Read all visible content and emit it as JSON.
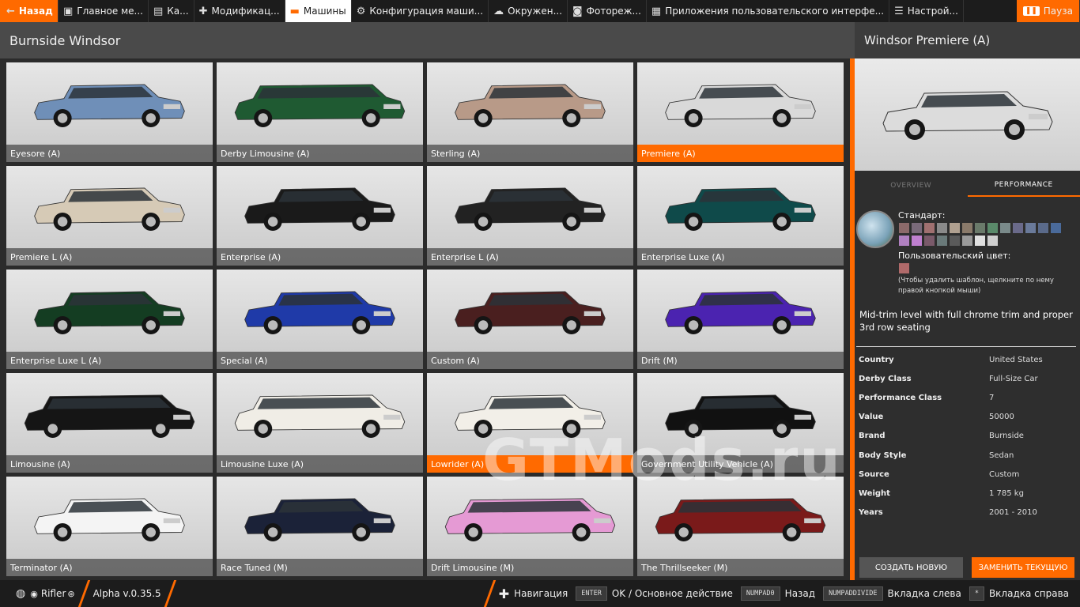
{
  "topbar": {
    "back_label": "Назад",
    "tabs": [
      {
        "label": "Главное ме...",
        "icon": "grid-icon"
      },
      {
        "label": "Ка...",
        "icon": "map-icon"
      },
      {
        "label": "Модификац...",
        "icon": "puzzle-icon"
      },
      {
        "label": "Машины",
        "icon": "car-icon",
        "active": true
      },
      {
        "label": "Конфигурация маши...",
        "icon": "engine-icon"
      },
      {
        "label": "Окружен...",
        "icon": "weather-icon"
      },
      {
        "label": "Фотореж...",
        "icon": "camera-icon"
      },
      {
        "label": "Приложения пользовательского интерфе...",
        "icon": "apps-icon"
      },
      {
        "label": "Настрой...",
        "icon": "sliders-icon"
      }
    ],
    "pause_label": "Пауза"
  },
  "left_header": {
    "title": "Burnside Windsor"
  },
  "vehicles": [
    {
      "label": "Eyesore (A)",
      "color": "#6f8fb8",
      "style": "sedan"
    },
    {
      "label": "Derby Limousine (A)",
      "color": "#1f5a32",
      "style": "limo"
    },
    {
      "label": "Sterling (A)",
      "color": "#b89a88",
      "style": "sedan"
    },
    {
      "label": "Premiere (A)",
      "color": "#d9d9d9",
      "style": "sedan",
      "selected": true
    },
    {
      "label": "Premiere L (A)",
      "color": "#d6cab6",
      "style": "sedan"
    },
    {
      "label": "Enterprise (A)",
      "color": "#1a1a1a",
      "style": "sedan"
    },
    {
      "label": "Enterprise L (A)",
      "color": "#222222",
      "style": "sedan"
    },
    {
      "label": "Enterprise Luxe (A)",
      "color": "#0f4a4a",
      "style": "sedan"
    },
    {
      "label": "Enterprise Luxe L (A)",
      "color": "#143d22",
      "style": "sedan"
    },
    {
      "label": "Special (A)",
      "color": "#1f3aa8",
      "style": "sedan"
    },
    {
      "label": "Custom (A)",
      "color": "#4a1f1f",
      "style": "sedan"
    },
    {
      "label": "Drift (M)",
      "color": "#4b23b0",
      "style": "sedan"
    },
    {
      "label": "Limousine (A)",
      "color": "#151515",
      "style": "limo"
    },
    {
      "label": "Limousine Luxe (A)",
      "color": "#f0ede6",
      "style": "limo"
    },
    {
      "label": "Lowrider (A)",
      "color": "#f2efe8",
      "style": "sedan",
      "selected": true
    },
    {
      "label": "Government Utility Vehicle (A)",
      "color": "#111111",
      "style": "sedan"
    },
    {
      "label": "Terminator (A)",
      "color": "#f4f4f4",
      "style": "sedan"
    },
    {
      "label": "Race Tuned (M)",
      "color": "#1b2238",
      "style": "sedan"
    },
    {
      "label": "Drift Limousine (M)",
      "color": "#e59ad4",
      "style": "limo"
    },
    {
      "label": "The Thrillseeker (M)",
      "color": "#7a1a1a",
      "style": "limo"
    }
  ],
  "right_panel": {
    "title": "Windsor Premiere (A)",
    "preview_color": "#dcdcdc",
    "tab_overview": "OVERVIEW",
    "tab_performance": "PERFORMANCE",
    "standard_label": "Стандарт:",
    "swatch_colors": [
      "#8c6a6a",
      "#7a6a7a",
      "#a07070",
      "#8a8a8a",
      "#b0a090",
      "#8a7a6a",
      "#6a7a6a",
      "#5a8a6a",
      "#7a8a8a",
      "#6a6a8a",
      "#6a7a9a",
      "#5a6a8a",
      "#4a6a9a",
      "#b080c0",
      "#c080d0",
      "#7a5a6a",
      "#6a7a7a",
      "#5a5a5a",
      "#9a9a9a",
      "#e0e0e0",
      "#cfcfcf"
    ],
    "custom_label": "Пользовательский цвет:",
    "hint": "(Чтобы удалить шаблон, щелкните по нему правой кнопкой мыши)",
    "description": "Mid-trim level with full chrome trim and proper 3rd row seating",
    "specs": [
      {
        "key": "Country",
        "value": "United States"
      },
      {
        "key": "Derby Class",
        "value": "Full-Size Car"
      },
      {
        "key": "Performance Class",
        "value": "7"
      },
      {
        "key": "Value",
        "value": "50000"
      },
      {
        "key": "Brand",
        "value": "Burnside"
      },
      {
        "key": "Body Style",
        "value": "Sedan"
      },
      {
        "key": "Source",
        "value": "Custom"
      },
      {
        "key": "Weight",
        "value": "1 785 kg"
      },
      {
        "key": "Years",
        "value": "2001 - 2010"
      }
    ],
    "btn_new": "СОЗДАТЬ НОВУЮ",
    "btn_replace": "ЗАМЕНИТЬ ТЕКУЩУЮ"
  },
  "bottom": {
    "user": "Rifler",
    "version": "Alpha v.0.35.5",
    "nav_label": "Навигация",
    "hints": [
      {
        "key": "ENTER",
        "label": "OK / Основное действие"
      },
      {
        "key": "NUMPAD0",
        "label": "Назад"
      },
      {
        "key": "NUMPADDIVIDE",
        "label": "Вкладка слева"
      },
      {
        "key": "*",
        "label": "Вкладка справа"
      }
    ]
  },
  "watermark": "GTMods.ru"
}
